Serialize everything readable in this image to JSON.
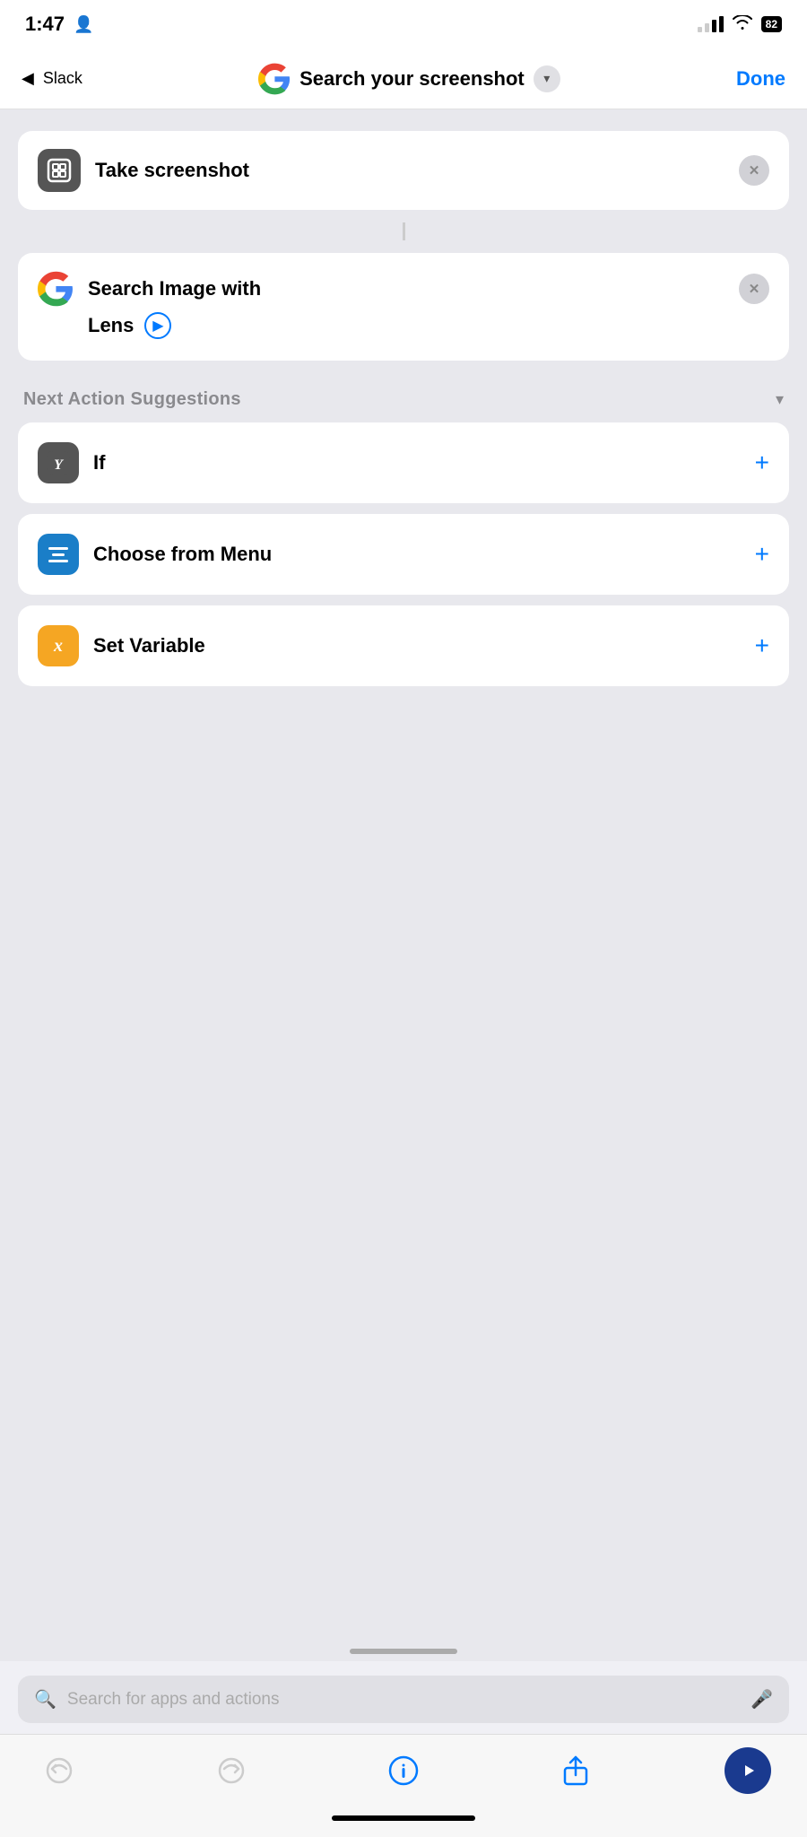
{
  "statusBar": {
    "time": "1:47",
    "personIcon": "👤",
    "batteryLevel": "82"
  },
  "navBar": {
    "backLabel": "Slack",
    "title": "Search your screenshot",
    "doneLabel": "Done"
  },
  "actions": [
    {
      "id": "take-screenshot",
      "label": "Take screenshot",
      "iconType": "screenshot"
    },
    {
      "id": "search-image",
      "label": "Search Image with",
      "labelLine2": "Lens",
      "iconType": "google"
    }
  ],
  "nextActions": {
    "sectionTitle": "Next Action Suggestions",
    "items": [
      {
        "id": "if",
        "label": "If",
        "iconType": "if",
        "iconText": "Y"
      },
      {
        "id": "choose-from-menu",
        "label": "Choose from Menu",
        "iconType": "menu"
      },
      {
        "id": "set-variable",
        "label": "Set Variable",
        "iconType": "var",
        "iconText": "x"
      }
    ]
  },
  "searchBar": {
    "placeholder": "Search for apps and actions"
  },
  "toolbar": {
    "undoLabel": "↺",
    "redoLabel": "↻",
    "infoLabel": "ⓘ",
    "shareLabel": "⬆",
    "playLabel": "▶"
  }
}
